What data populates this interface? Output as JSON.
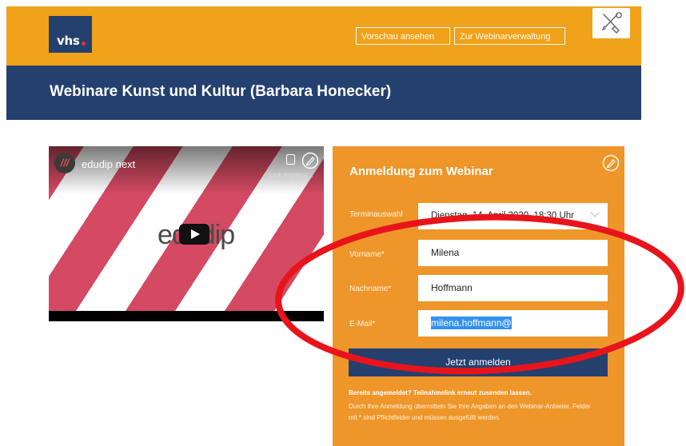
{
  "header": {
    "logo_text": "vhs",
    "preview_button": "Vorschau ansehen",
    "admin_button": "Zur Webinarverwaltung",
    "tools_icon": "tools-icon"
  },
  "page": {
    "title": "Webinare Kunst und Kultur (Barbara Honecker)"
  },
  "video": {
    "channel": "edudip next",
    "copy_label": "Link kopiere...",
    "logo_text": "edudip"
  },
  "form": {
    "title": "Anmeldung zum Webinar",
    "fields": {
      "date_label": "Terminauswahl",
      "date_value": "Dienstag, 14. April 2020, 18:30 Uhr",
      "firstname_label": "Vorname*",
      "firstname_value": "Milena",
      "lastname_label": "Nachname*",
      "lastname_value": "Hoffmann",
      "email_label": "E-Mail*",
      "email_value": "milena.hoffmann@"
    },
    "submit_label": "Jetzt anmelden",
    "resend_text": "Bereits angemeldet? Teilnahmelink erneut zusenden lassen.",
    "consent_text": "Durch Ihre Anmeldung übermitteln Sie Ihre Angaben an den Webinar-Anbieter. Felder mit * sind Pflichtfelder und müssen ausgefüllt werden."
  },
  "colors": {
    "header_orange": "#f0a21a",
    "panel_orange": "#ee9629",
    "navy": "#24406f",
    "annotation_red": "#e8141c"
  }
}
